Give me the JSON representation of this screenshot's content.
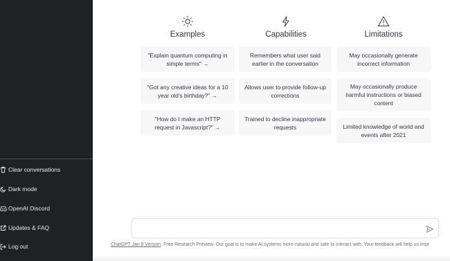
{
  "columns": [
    {
      "icon": "sun-icon",
      "title": "Examples",
      "cards": [
        "\"Explain quantum computing in simple terms\" →",
        "\"Got any creative ideas for a 10 year old's birthday?\" →",
        "\"How do I make an HTTP request in Javascript?\" →"
      ]
    },
    {
      "icon": "lightning-icon",
      "title": "Capabilities",
      "cards": [
        "Remembers what user said earlier in the conversation",
        "Allows user to provide follow-up corrections",
        "Trained to decline inappropriate requests"
      ]
    },
    {
      "icon": "warning-icon",
      "title": "Limitations",
      "cards": [
        "May occasionally generate incorrect information",
        "May occasionally produce harmful instructions or biased content",
        "Limited knowledge of world and events after 2021"
      ]
    }
  ],
  "sidebar": {
    "items": [
      {
        "label": "Clear conversations",
        "icon": "trash-icon"
      },
      {
        "label": "Dark mode",
        "icon": "moon-icon"
      },
      {
        "label": "OpenAI Discord",
        "icon": "discord-icon"
      },
      {
        "label": "Updates & FAQ",
        "icon": "external-link-icon"
      },
      {
        "label": "Log out",
        "icon": "logout-icon"
      }
    ]
  },
  "composer": {
    "placeholder": "",
    "send_icon": "send-icon"
  },
  "footer": {
    "link": "ChatGPT Jan 9 Version",
    "text": ". Free Research Preview. Our goal is to make AI systems more natural and safe to interact with. Your feedback will help us impr"
  },
  "colors": {
    "sidebar_bg": "#202123",
    "card_bg": "#f7f7f8",
    "text": "#343541"
  }
}
